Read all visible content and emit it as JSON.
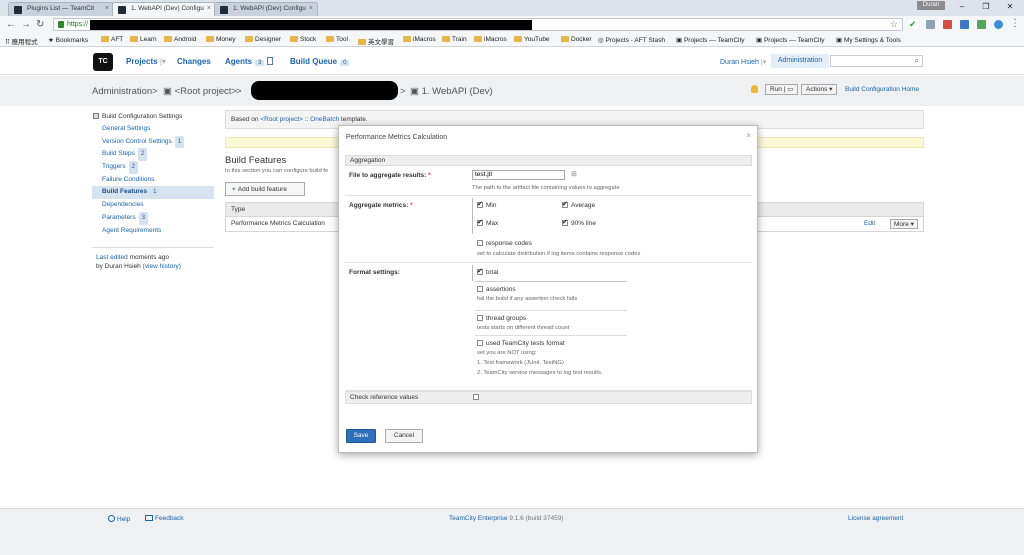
{
  "browser": {
    "tabs": [
      {
        "title": "Plugins List — TeamCit"
      },
      {
        "title": "1. WebAPI (Dev) Configu"
      },
      {
        "title": "1. WebAPI (Dev) Configu"
      }
    ],
    "user_chip": "Duran",
    "url_prefix": "https://",
    "bookmarks": [
      "應用程式",
      "Bookmarks",
      "AFT",
      "Learn",
      "Android",
      "Money",
      "Designer",
      "Stock",
      "Tool",
      "英文學習",
      "iMacros",
      "Train",
      "iMacros",
      "YouTube",
      "Docker",
      "Projects - AFT Stash",
      "Projects — TeamCity",
      "Projects — TeamCity",
      "My Settings & Tools"
    ]
  },
  "header": {
    "logo": "TC",
    "projects": "Projects",
    "changes": "Changes",
    "agents": "Agents",
    "agents_count": "3",
    "build_queue": "Build Queue",
    "build_queue_count": "0",
    "user": "Duran Hsieh",
    "administration": "Administration"
  },
  "breadcrumb": {
    "admin": "Administration",
    "sep": ">",
    "root": "<Root project>",
    "current": "1. WebAPI (Dev)",
    "run": "Run",
    "actions": "Actions",
    "home": "Build Configuration Home"
  },
  "sidebar": {
    "title": "Build Configuration Settings",
    "items": [
      {
        "label": "General Settings",
        "badge": ""
      },
      {
        "label": "Version Control Settings",
        "badge": "1"
      },
      {
        "label": "Build Steps",
        "badge": "2"
      },
      {
        "label": "Triggers",
        "badge": "2"
      },
      {
        "label": "Failure Conditions",
        "badge": ""
      },
      {
        "label": "Build Features",
        "badge": "1"
      },
      {
        "label": "Dependencies",
        "badge": ""
      },
      {
        "label": "Parameters",
        "badge": "3"
      },
      {
        "label": "Agent Requirements",
        "badge": ""
      }
    ],
    "last_edited_link": "Last edited",
    "last_edited_time": "moments ago",
    "last_edited_by": "by Duran Hsieh",
    "view_history": "(view history)"
  },
  "main": {
    "based_on": "Based on",
    "root_link": "<Root project>",
    "sep": "::",
    "template_link": "OneBatch",
    "template_suffix": "template.",
    "title": "Build Features",
    "desc": "In this section you can configure build fe",
    "add_button": "Add build feature",
    "table_header": "Type",
    "row_name": "Performance Metrics Calculation",
    "row_edit": "Edit",
    "row_more": "More"
  },
  "modal": {
    "title": "Performance Metrics Calculation",
    "close": "×",
    "section_aggregation": "Aggregation",
    "file_label": "File to aggregate results:",
    "file_value": "test.jtl",
    "file_hint": "The path to the artifact file containing values to aggregate",
    "metrics_label": "Aggregate metrics:",
    "metrics": {
      "min": "Min",
      "average": "Average",
      "max": "Max",
      "line90": "90% line",
      "response_codes": "response codes",
      "response_codes_hint": "set to calculate distribution if log items contains response codes"
    },
    "format_label": "Format settings:",
    "format": {
      "total": "total",
      "assertions": "assertions",
      "assertions_hint": "fail the build if any assertion check fails",
      "thread_groups": "thread groups",
      "thread_groups_hint": "tests starts on different thread count",
      "used_tc": "used TeamCity tests format",
      "used_tc_hint1": "set you are NOT using:",
      "used_tc_hint2": "1. Test framework (JUnit, TestNG)",
      "used_tc_hint3": "2. TeamCity service messages to log test results."
    },
    "check_ref_label": "Check reference values",
    "save": "Save",
    "cancel": "Cancel",
    "required_mark": "*"
  },
  "footer": {
    "help": "Help",
    "feedback": "Feedback",
    "product": "TeamCity Enterprise",
    "version": "9.1.6 (build 37459)",
    "license": "License agreement"
  },
  "colors": {
    "link": "#1a64b0",
    "save_button": "#2e6fb9",
    "admin_tab": "#e3eef8"
  }
}
